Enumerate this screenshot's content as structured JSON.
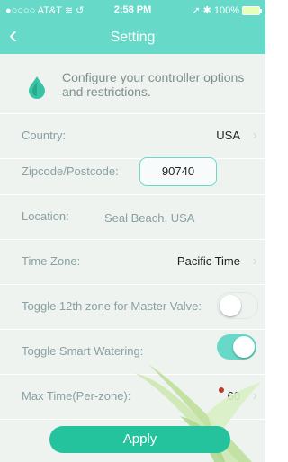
{
  "status_bar": {
    "carrier": "●○○○○ AT&T ≋ ↺",
    "time": "2:58 PM",
    "battery": "100%"
  },
  "nav": {
    "back_icon": "chevron-left-icon",
    "title": "Setting"
  },
  "intro": {
    "icon": "water-drop-icon",
    "text": "Configure your controller options and restrictions."
  },
  "rows": {
    "country": {
      "label": "Country:",
      "value": "USA"
    },
    "zip": {
      "label": "Zipcode/Postcode:",
      "value": "90740"
    },
    "location": {
      "label": "Location:",
      "value": "Seal Beach, USA"
    },
    "timezone": {
      "label": "Time Zone:",
      "value": "Pacific Time"
    },
    "master_valve": {
      "label": "Toggle 12th zone for Master Valve:",
      "state": false
    },
    "smart_watering": {
      "label": "Toggle Smart Watering:",
      "state": true
    },
    "max_time": {
      "label": "Max Time(Per-zone):",
      "value": "60"
    }
  },
  "apply_label": "Apply",
  "colors": {
    "teal": "#67d9c8",
    "button": "#25c39d",
    "background": "#eef3ef"
  }
}
